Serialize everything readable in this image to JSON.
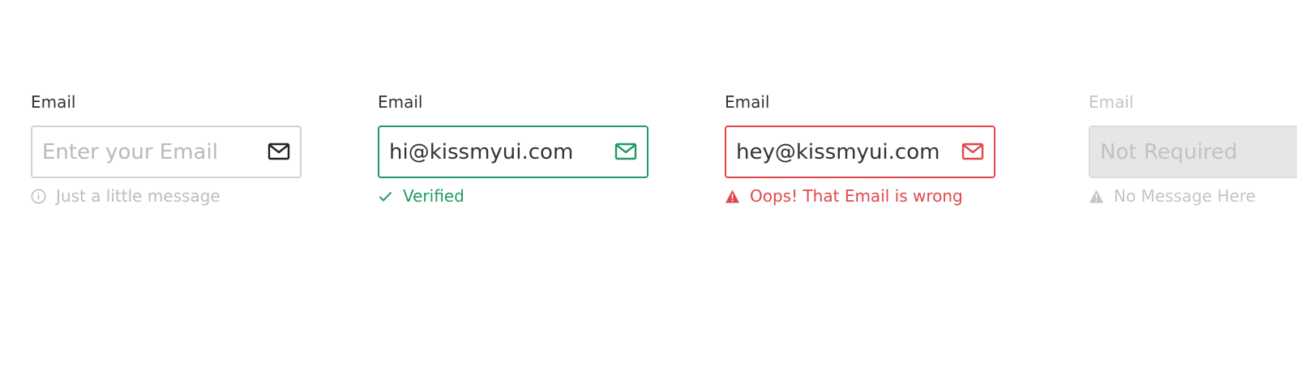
{
  "fields": [
    {
      "label": "Email",
      "placeholder": "Enter your Email",
      "value": "",
      "state": "default",
      "message": "Just a little message",
      "message_icon": "info-icon",
      "input_icon": "mail-icon"
    },
    {
      "label": "Email",
      "placeholder": "",
      "value": "hi@kissmyui.com",
      "state": "success",
      "message": "Verified",
      "message_icon": "check-icon",
      "input_icon": "mail-icon"
    },
    {
      "label": "Email",
      "placeholder": "",
      "value": "hey@kissmyui.com",
      "state": "error",
      "message": "Oops! That Email is wrong",
      "message_icon": "warning-icon",
      "input_icon": "mail-icon"
    },
    {
      "label": "Email",
      "placeholder": "Not Required",
      "value": "",
      "state": "disabled",
      "message": "No Message Here",
      "message_icon": "warning-icon",
      "input_icon": ""
    }
  ],
  "colors": {
    "text": "#333333",
    "muted": "#bcbcbc",
    "success": "#1f9a63",
    "error": "#e0484a",
    "disabled_bg": "#e6e6e6",
    "border": "#d2d2d2"
  }
}
